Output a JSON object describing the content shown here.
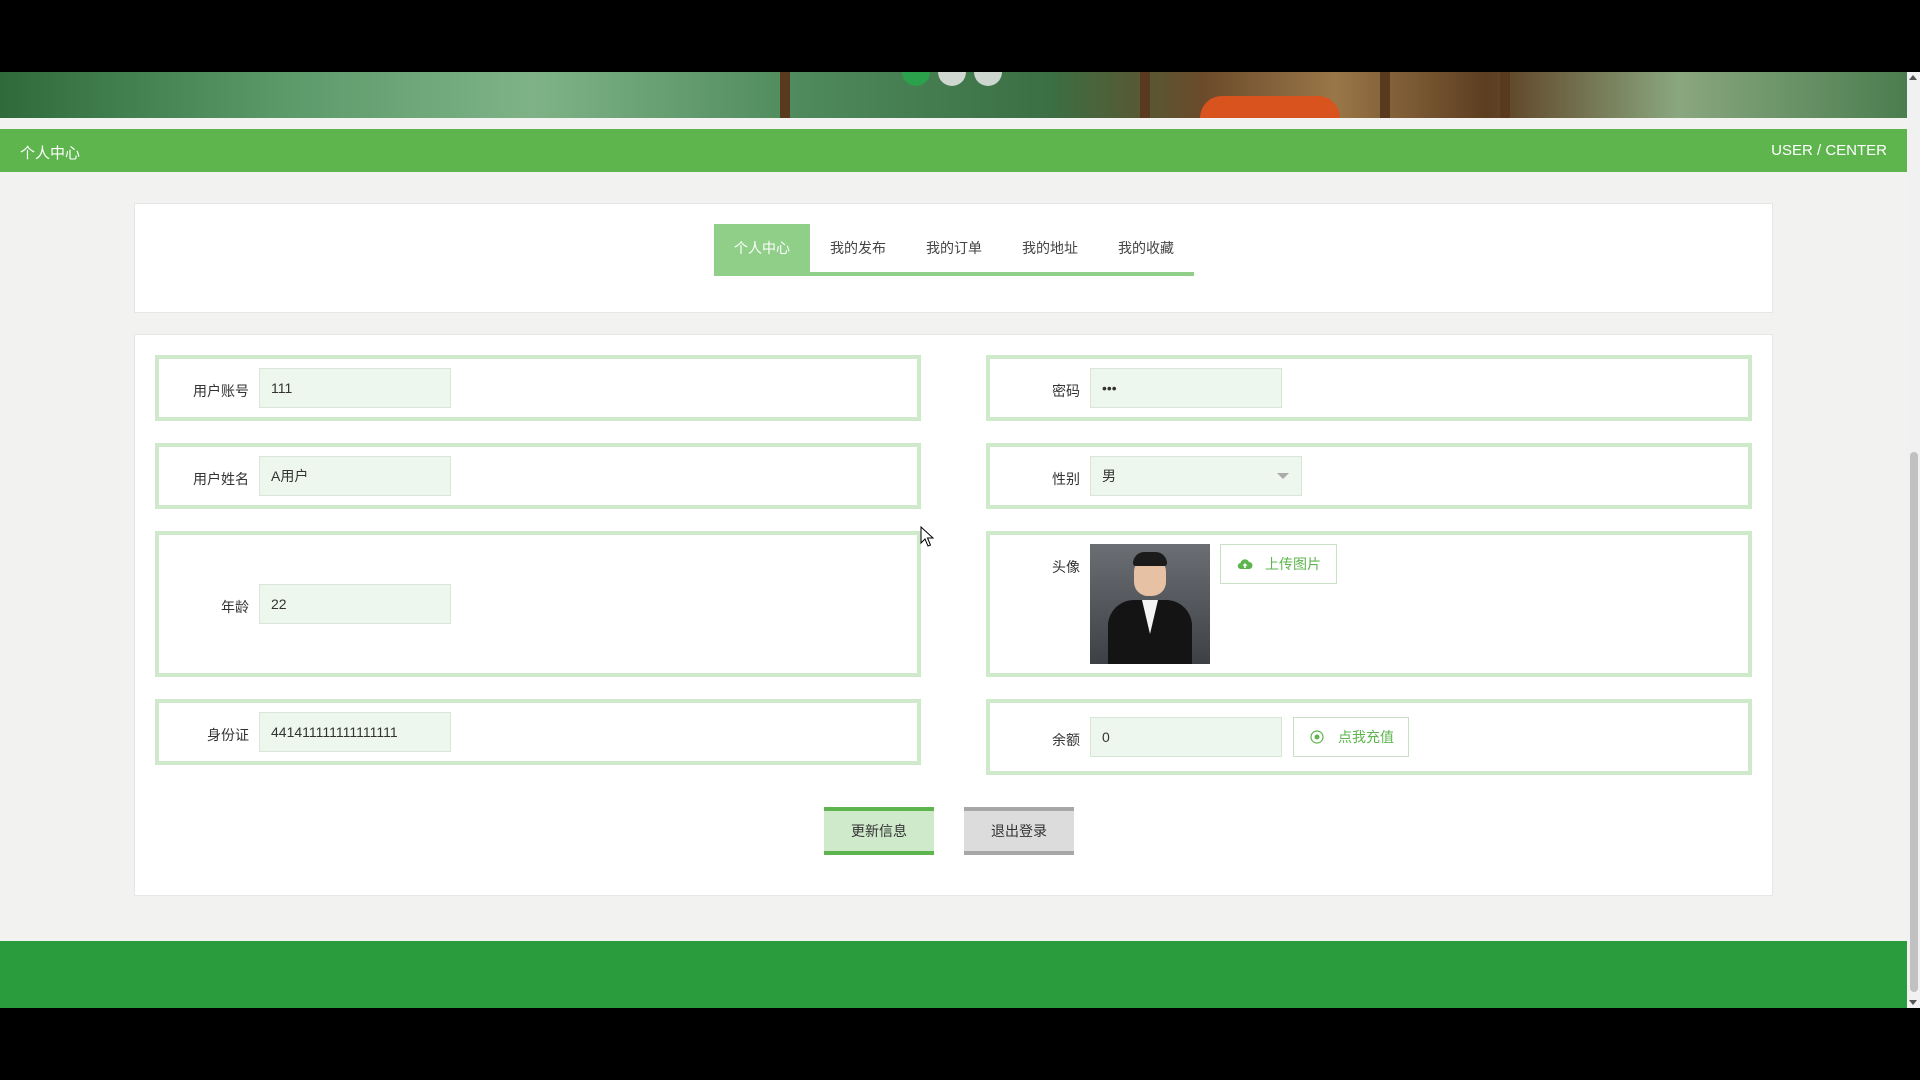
{
  "header": {
    "title": "个人中心",
    "subtitle": "USER / CENTER"
  },
  "carousel": {
    "slides": 3,
    "active_index": 0
  },
  "tabs": [
    {
      "label": "个人中心",
      "active": true
    },
    {
      "label": "我的发布",
      "active": false
    },
    {
      "label": "我的订单",
      "active": false
    },
    {
      "label": "我的地址",
      "active": false
    },
    {
      "label": "我的收藏",
      "active": false
    }
  ],
  "form": {
    "username": {
      "label": "用户账号",
      "value": "111"
    },
    "password": {
      "label": "密码",
      "value": "•••"
    },
    "name": {
      "label": "用户姓名",
      "value": "A用户"
    },
    "gender": {
      "label": "性别",
      "value": "男"
    },
    "age": {
      "label": "年龄",
      "value": "22"
    },
    "avatar": {
      "label": "头像",
      "upload_label": "上传图片"
    },
    "id_card": {
      "label": "身份证",
      "value": "441411111111111111"
    },
    "balance": {
      "label": "余额",
      "value": "0",
      "recharge_label": "点我充值"
    }
  },
  "actions": {
    "update": "更新信息",
    "logout": "退出登录"
  },
  "colors": {
    "accent": "#5eb54e",
    "footer": "#2a9c3e",
    "tab_active": "#8fcf88",
    "field_border": "#cfe9cb"
  }
}
